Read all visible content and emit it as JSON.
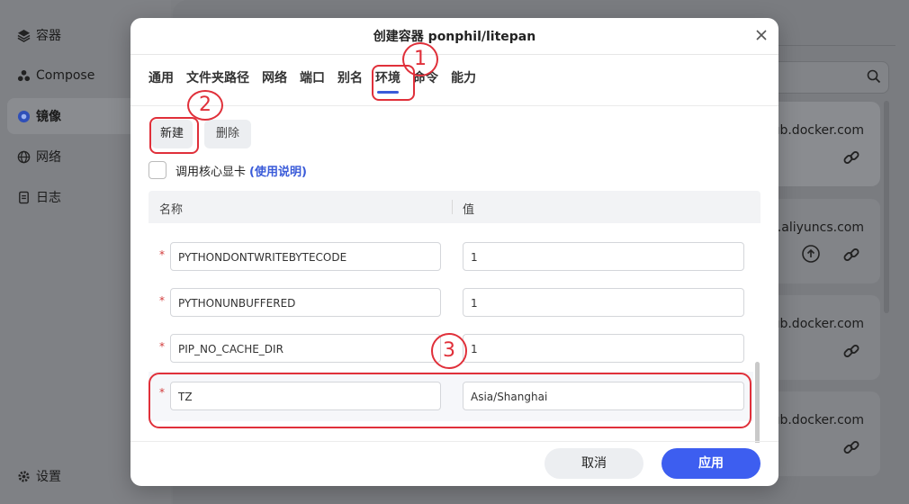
{
  "sidebar": {
    "items": [
      {
        "label": "容器",
        "icon": "layers-icon"
      },
      {
        "label": "Compose",
        "icon": "compose-icon"
      },
      {
        "label": "镜像",
        "icon": "image-icon"
      },
      {
        "label": "网络",
        "icon": "globe-icon"
      },
      {
        "label": "日志",
        "icon": "log-icon"
      }
    ],
    "settings_label": "设置"
  },
  "background_cards": [
    {
      "url": "ub.docker.com"
    },
    {
      "url": "u.aliyuncs.com"
    },
    {
      "url": "ub.docker.com"
    },
    {
      "url": "ub.docker.com"
    }
  ],
  "modal": {
    "title": "创建容器 ponphil/litepan",
    "tabs": [
      "通用",
      "文件夹路径",
      "网络",
      "端口",
      "别名",
      "环境",
      "命令",
      "能力"
    ],
    "active_tab": "环境",
    "new_button": "新建",
    "delete_button": "删除",
    "gpu_label": "调用核心显卡",
    "gpu_link": "(使用说明)",
    "columns": {
      "name": "名称",
      "value": "值"
    },
    "rows": [
      {
        "name": "PYTHONDONTWRITEBYTECODE",
        "value": "1"
      },
      {
        "name": "PYTHONUNBUFFERED",
        "value": "1"
      },
      {
        "name": "PIP_NO_CACHE_DIR",
        "value": "1"
      },
      {
        "name": "TZ",
        "value": "Asia/Shanghai"
      }
    ],
    "required_mark": "*",
    "cancel_button": "取消",
    "apply_button": "应用"
  },
  "annotations": [
    "1",
    "2",
    "3"
  ],
  "colors": {
    "accent": "#3d5ef0",
    "annotation": "#e0303a",
    "required": "#d23b3b"
  }
}
